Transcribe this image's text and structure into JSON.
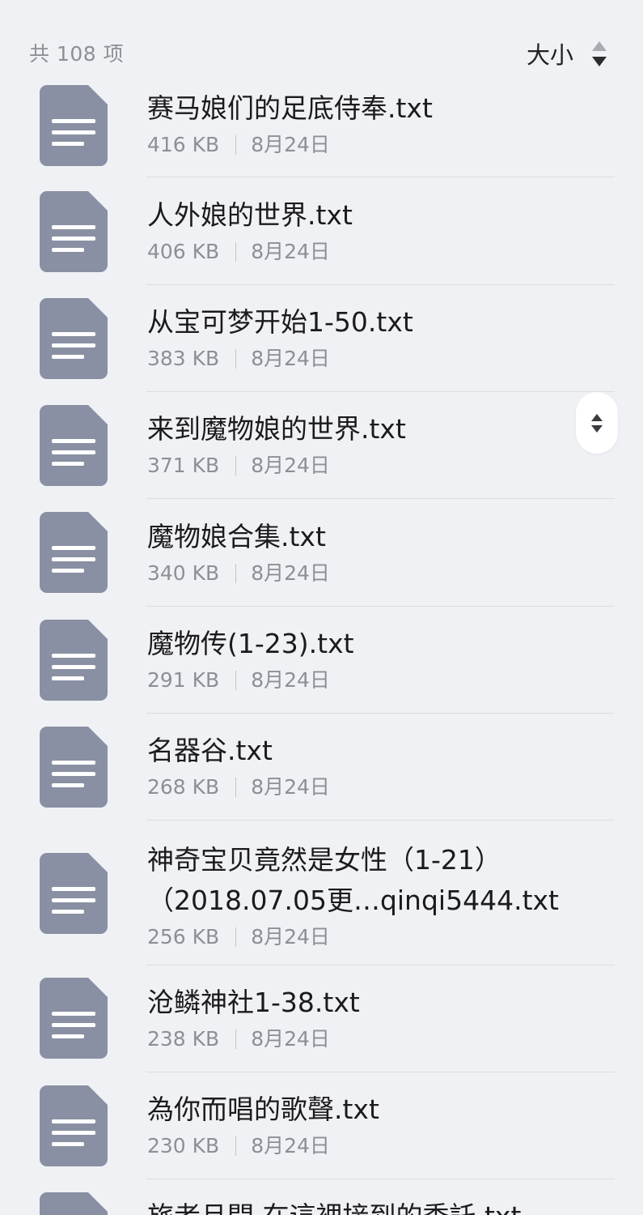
{
  "header": {
    "item_count": "共 108 项",
    "sort_label": "大小"
  },
  "colors": {
    "background": "#f0f1f4",
    "file_icon": "#8990a3",
    "text_primary": "#1b1b1d",
    "text_secondary": "#8d8f95"
  },
  "files": [
    {
      "name": "赛马娘们的足底侍奉.txt",
      "size": "416 KB",
      "date": "8月24日",
      "icon": "document-icon"
    },
    {
      "name": "人外娘的世界.txt",
      "size": "406 KB",
      "date": "8月24日",
      "icon": "document-icon"
    },
    {
      "name": "从宝可梦开始1-50.txt",
      "size": "383 KB",
      "date": "8月24日",
      "icon": "document-icon"
    },
    {
      "name": "来到魔物娘的世界.txt",
      "size": "371 KB",
      "date": "8月24日",
      "icon": "document-icon"
    },
    {
      "name": "魔物娘合集.txt",
      "size": "340 KB",
      "date": "8月24日",
      "icon": "document-icon"
    },
    {
      "name": "魔物传(1-23).txt",
      "size": "291 KB",
      "date": "8月24日",
      "icon": "document-icon"
    },
    {
      "name": "名器谷.txt",
      "size": "268 KB",
      "date": "8月24日",
      "icon": "document-icon"
    },
    {
      "name_line1": "神奇宝贝竟然是女性（1-21）",
      "name_line2": "（2018.07.05更…qinqi5444.txt",
      "size": "256 KB",
      "date": "8月24日",
      "icon": "document-icon"
    },
    {
      "name": "沧鳞神社1-38.txt",
      "size": "238 KB",
      "date": "8月24日",
      "icon": "document-icon"
    },
    {
      "name": "為你而唱的歌聲.txt",
      "size": "230 KB",
      "date": "8月24日",
      "icon": "document-icon"
    },
    {
      "name": "旅者旦間 在這裡接到的委託.txt",
      "icon": "document-icon"
    }
  ]
}
